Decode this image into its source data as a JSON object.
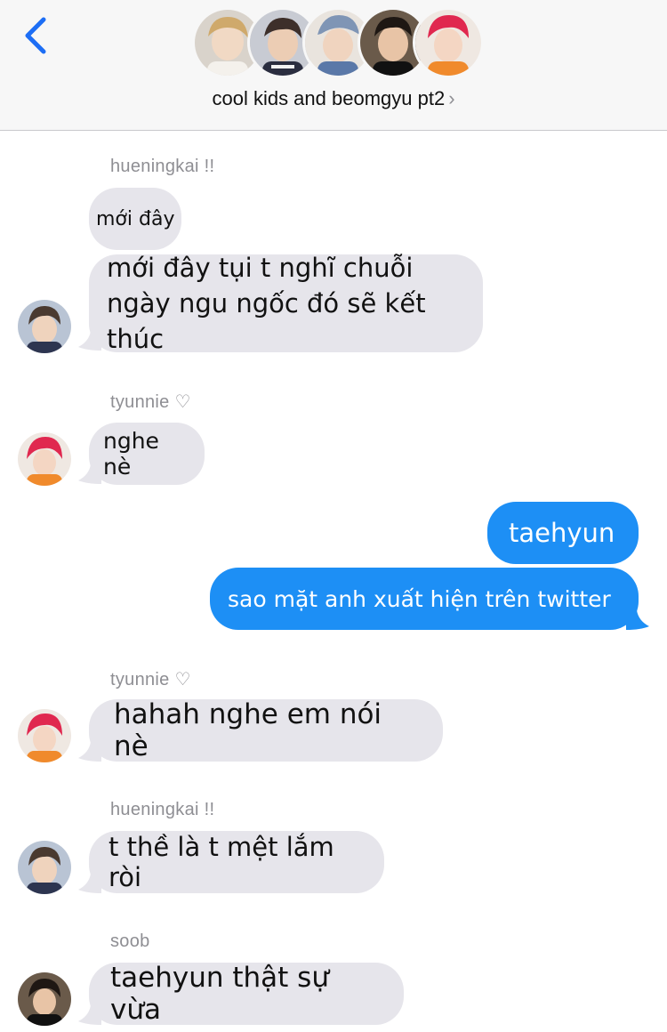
{
  "header": {
    "group_name": "cool kids and beomgyu pt2",
    "chevron": "›",
    "back_icon": "chevron-left-icon",
    "accent_color": "#1d6ef5"
  },
  "messages": [
    {
      "sender": "hueningkai !!",
      "texts": [
        "mới đây",
        "mới đây tụi t nghĩ chuỗi ngày ngu ngốc đó sẽ kết thúc"
      ]
    },
    {
      "sender": "tyunnie ♡",
      "texts": [
        "nghe nè"
      ]
    },
    {
      "outgoing": [
        "taehyun",
        "sao mặt anh xuất hiện trên twitter"
      ]
    },
    {
      "sender": "tyunnie ♡",
      "texts": [
        "hahah nghe em nói nè"
      ]
    },
    {
      "sender": "hueningkai !!",
      "texts": [
        "t thề là t mệt lắm ròi"
      ]
    },
    {
      "sender": "soob",
      "texts": [
        "taehyun thật sự vừa"
      ]
    }
  ],
  "colors": {
    "incoming_bubble": "#e6e5eb",
    "outgoing_bubble": "#1d8ff5",
    "sender_label": "#8e8e93"
  }
}
